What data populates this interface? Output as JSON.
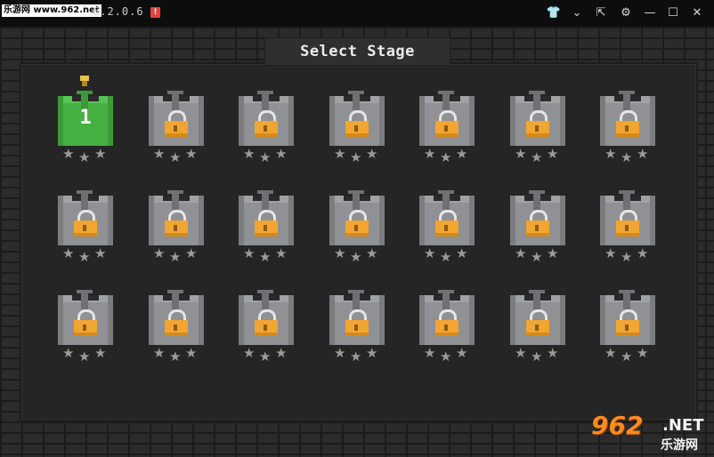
{
  "window": {
    "watermark_url": "乐游网 www.962.net",
    "app_title": "6.2.0.6",
    "alert_badge": "!",
    "buttons": {
      "shirt": "👕",
      "chevron": "⌄",
      "pin": "⇱",
      "settings": "⚙",
      "minimize": "—",
      "maximize": "☐",
      "close": "✕"
    }
  },
  "game": {
    "title": "Select Stage",
    "stages": [
      {
        "label": "1",
        "locked": false,
        "stars": 0
      },
      {
        "label": "",
        "locked": true,
        "stars": 0
      },
      {
        "label": "",
        "locked": true,
        "stars": 0
      },
      {
        "label": "",
        "locked": true,
        "stars": 0
      },
      {
        "label": "",
        "locked": true,
        "stars": 0
      },
      {
        "label": "",
        "locked": true,
        "stars": 0
      },
      {
        "label": "",
        "locked": true,
        "stars": 0
      },
      {
        "label": "",
        "locked": true,
        "stars": 0
      },
      {
        "label": "",
        "locked": true,
        "stars": 0
      },
      {
        "label": "",
        "locked": true,
        "stars": 0
      },
      {
        "label": "",
        "locked": true,
        "stars": 0
      },
      {
        "label": "",
        "locked": true,
        "stars": 0
      },
      {
        "label": "",
        "locked": true,
        "stars": 0
      },
      {
        "label": "",
        "locked": true,
        "stars": 0
      },
      {
        "label": "",
        "locked": true,
        "stars": 0
      },
      {
        "label": "",
        "locked": true,
        "stars": 0
      },
      {
        "label": "",
        "locked": true,
        "stars": 0
      },
      {
        "label": "",
        "locked": true,
        "stars": 0
      },
      {
        "label": "",
        "locked": true,
        "stars": 0
      },
      {
        "label": "",
        "locked": true,
        "stars": 0
      },
      {
        "label": "",
        "locked": true,
        "stars": 0
      }
    ],
    "colors": {
      "unlocked": "#46b042",
      "locked": "#8f9195",
      "lock": "#f2a531",
      "star_empty": "#9a9a9a"
    }
  },
  "site_watermark": {
    "number": "962",
    "domain": ".NET",
    "name": "乐游网"
  }
}
